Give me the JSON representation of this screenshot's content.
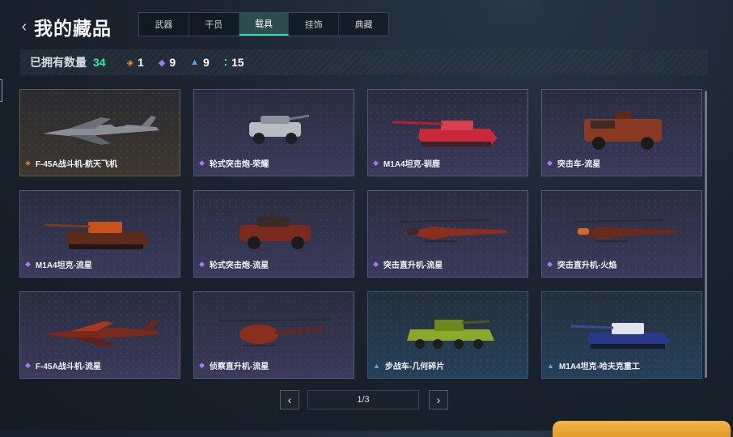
{
  "header": {
    "back_icon": "chevron-left-icon",
    "title": "我的藏品"
  },
  "tabs": [
    {
      "label": "武器",
      "active": false
    },
    {
      "label": "干员",
      "active": false
    },
    {
      "label": "载具",
      "active": true
    },
    {
      "label": "挂饰",
      "active": false
    },
    {
      "label": "典藏",
      "active": false
    }
  ],
  "stats": {
    "owned_label": "已拥有数量",
    "owned_count": "34",
    "rarity_counts": [
      {
        "icon": "orange-diamond-icon",
        "color": "#e58a3a",
        "count": "1"
      },
      {
        "icon": "purple-diamond-icon",
        "color": "#a978f0",
        "count": "9"
      },
      {
        "icon": "blue-triangle-icon",
        "color": "#4ea8f0",
        "count": "9"
      },
      {
        "icon": "teal-dots-icon",
        "color": "#3ee6c8",
        "count": "15"
      }
    ]
  },
  "items": [
    {
      "name": "F-45A战斗机-航天飞机",
      "rarity": "gold"
    },
    {
      "name": "轮式突击炮-荣耀",
      "rarity": "purple"
    },
    {
      "name": "M1A4坦克-驯鹿",
      "rarity": "purple"
    },
    {
      "name": "突击车-流星",
      "rarity": "purple"
    },
    {
      "name": "M1A4坦克-流星",
      "rarity": "purple"
    },
    {
      "name": "轮式突击炮-流星",
      "rarity": "purple"
    },
    {
      "name": "突击直升机-流星",
      "rarity": "purple"
    },
    {
      "name": "突击直升机-火焰",
      "rarity": "purple"
    },
    {
      "name": "F-45A战斗机-流星",
      "rarity": "purple"
    },
    {
      "name": "侦察直升机-流星",
      "rarity": "purple"
    },
    {
      "name": "步战车-几何碎片",
      "rarity": "blue"
    },
    {
      "name": "M1A4坦克-哈夫克重工",
      "rarity": "blue"
    }
  ],
  "pagination": {
    "prev_icon": "chevron-left-icon",
    "next_icon": "chevron-right-icon",
    "page_text": "1/3"
  },
  "colors": {
    "accent": "#3ee6a8",
    "gold": "#e58a3a",
    "purple": "#a978f0",
    "blue": "#4ea8f0"
  }
}
